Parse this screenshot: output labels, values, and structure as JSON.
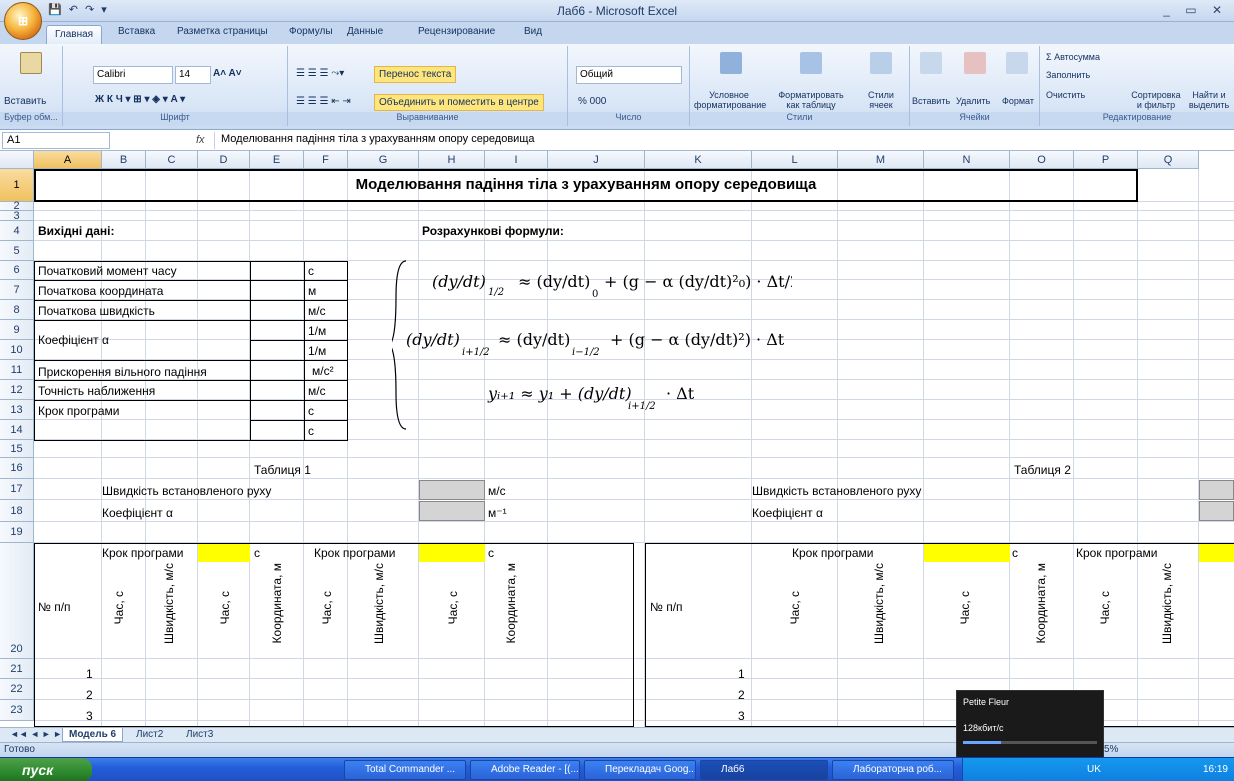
{
  "window": {
    "title": "Лаб6 - Microsoft Excel",
    "office_button": "⊞"
  },
  "tabs": [
    "Главная",
    "Вставка",
    "Разметка страницы",
    "Формулы",
    "Данные",
    "Рецензирование",
    "Вид"
  ],
  "ribbon": {
    "clipboard": {
      "label": "Буфер обм...",
      "paste": "Вставить"
    },
    "font": {
      "label": "Шрифт",
      "name": "Calibri",
      "size": "14"
    },
    "alignment": {
      "label": "Выравнивание",
      "wrap": "Перенос текста",
      "merge": "Объединить и поместить в центре"
    },
    "number": {
      "label": "Число",
      "format": "Общий",
      "pct": "% 000"
    },
    "styles": {
      "label": "Стили",
      "cond": "Условное форматирование",
      "table": "Форматировать как таблицу",
      "cell": "Стили ячеек"
    },
    "cells": {
      "label": "Ячейки",
      "insert": "Вставить",
      "delete": "Удалить",
      "format": "Формат"
    },
    "editing": {
      "label": "Редактирование",
      "autosum": "Σ Автосумма",
      "fill": "Заполнить",
      "clear": "Очистить",
      "sort": "Сортировка и фильтр",
      "find": "Найти и выделить"
    }
  },
  "formula_bar": {
    "name_box": "A1",
    "fx": "fx",
    "content": "Моделювання падіння тіла з урахуванням опору середовища"
  },
  "columns": [
    "A",
    "B",
    "C",
    "D",
    "E",
    "F",
    "G",
    "H",
    "I",
    "J",
    "K",
    "L",
    "M",
    "N",
    "O",
    "P",
    "Q"
  ],
  "rows": [
    "1",
    "2",
    "3",
    "4",
    "5",
    "6",
    "7",
    "8",
    "9",
    "10",
    "11",
    "12",
    "13",
    "14",
    "15",
    "16",
    "17",
    "18",
    "19",
    "20",
    "21",
    "22",
    "23"
  ],
  "sheet": {
    "title": "Моделювання падіння тіла з урахуванням опору середовища",
    "input_header": "Вихідні дані:",
    "formulas_header": "Розрахункові формули:",
    "inputs": [
      {
        "label": "Початковий момент часу",
        "unit": "с"
      },
      {
        "label": "Початкова координата",
        "unit": "м"
      },
      {
        "label": "Початкова швидкість",
        "unit": "м/с"
      },
      {
        "label": "Коефіцієнт α",
        "unit": "1/м",
        "unit2": "1/м"
      },
      {
        "label": "Прискорення вільного падіння",
        "unit": "м/с²"
      },
      {
        "label": "Точність наближення",
        "unit": "м/с"
      },
      {
        "label": "Крок програми",
        "unit": "с",
        "unit2": "с"
      }
    ],
    "table1_caption": "Таблиця 1",
    "table2_caption": "Таблиця 2",
    "steady_speed": "Швидкість встановленого руху",
    "steady_unit": "м/с",
    "coef": "Коефіцієнт α",
    "coef_unit": "м⁻¹",
    "step": "Крок програми",
    "step_unit": "с",
    "num_header": "№ п/п",
    "col_time": "Час, с",
    "col_speed": "Швидкість, м/с",
    "col_coord": "Координата, м",
    "row_nums": [
      "1",
      "2",
      "3"
    ]
  },
  "sheet_tabs": [
    "Модель 6",
    "Лист2",
    "Лист3"
  ],
  "status": {
    "ready": "Готово",
    "zoom": "5%"
  },
  "taskbar": {
    "start": "пуск",
    "items": [
      "Total Commander ...",
      "Adobe Reader - [(...",
      "Перекладач Goog...",
      "Лаб6",
      "Лабораторна роб..."
    ],
    "lang": "UK",
    "clock": "16:19"
  },
  "media_popup": {
    "title": "Petite Fleur",
    "bitrate": "128кбит/с"
  },
  "colors": {
    "selected_header": "#f1c15f",
    "yellow": "#ffff00",
    "grey": "#d4d4d4",
    "taskbar": "#245edb"
  }
}
